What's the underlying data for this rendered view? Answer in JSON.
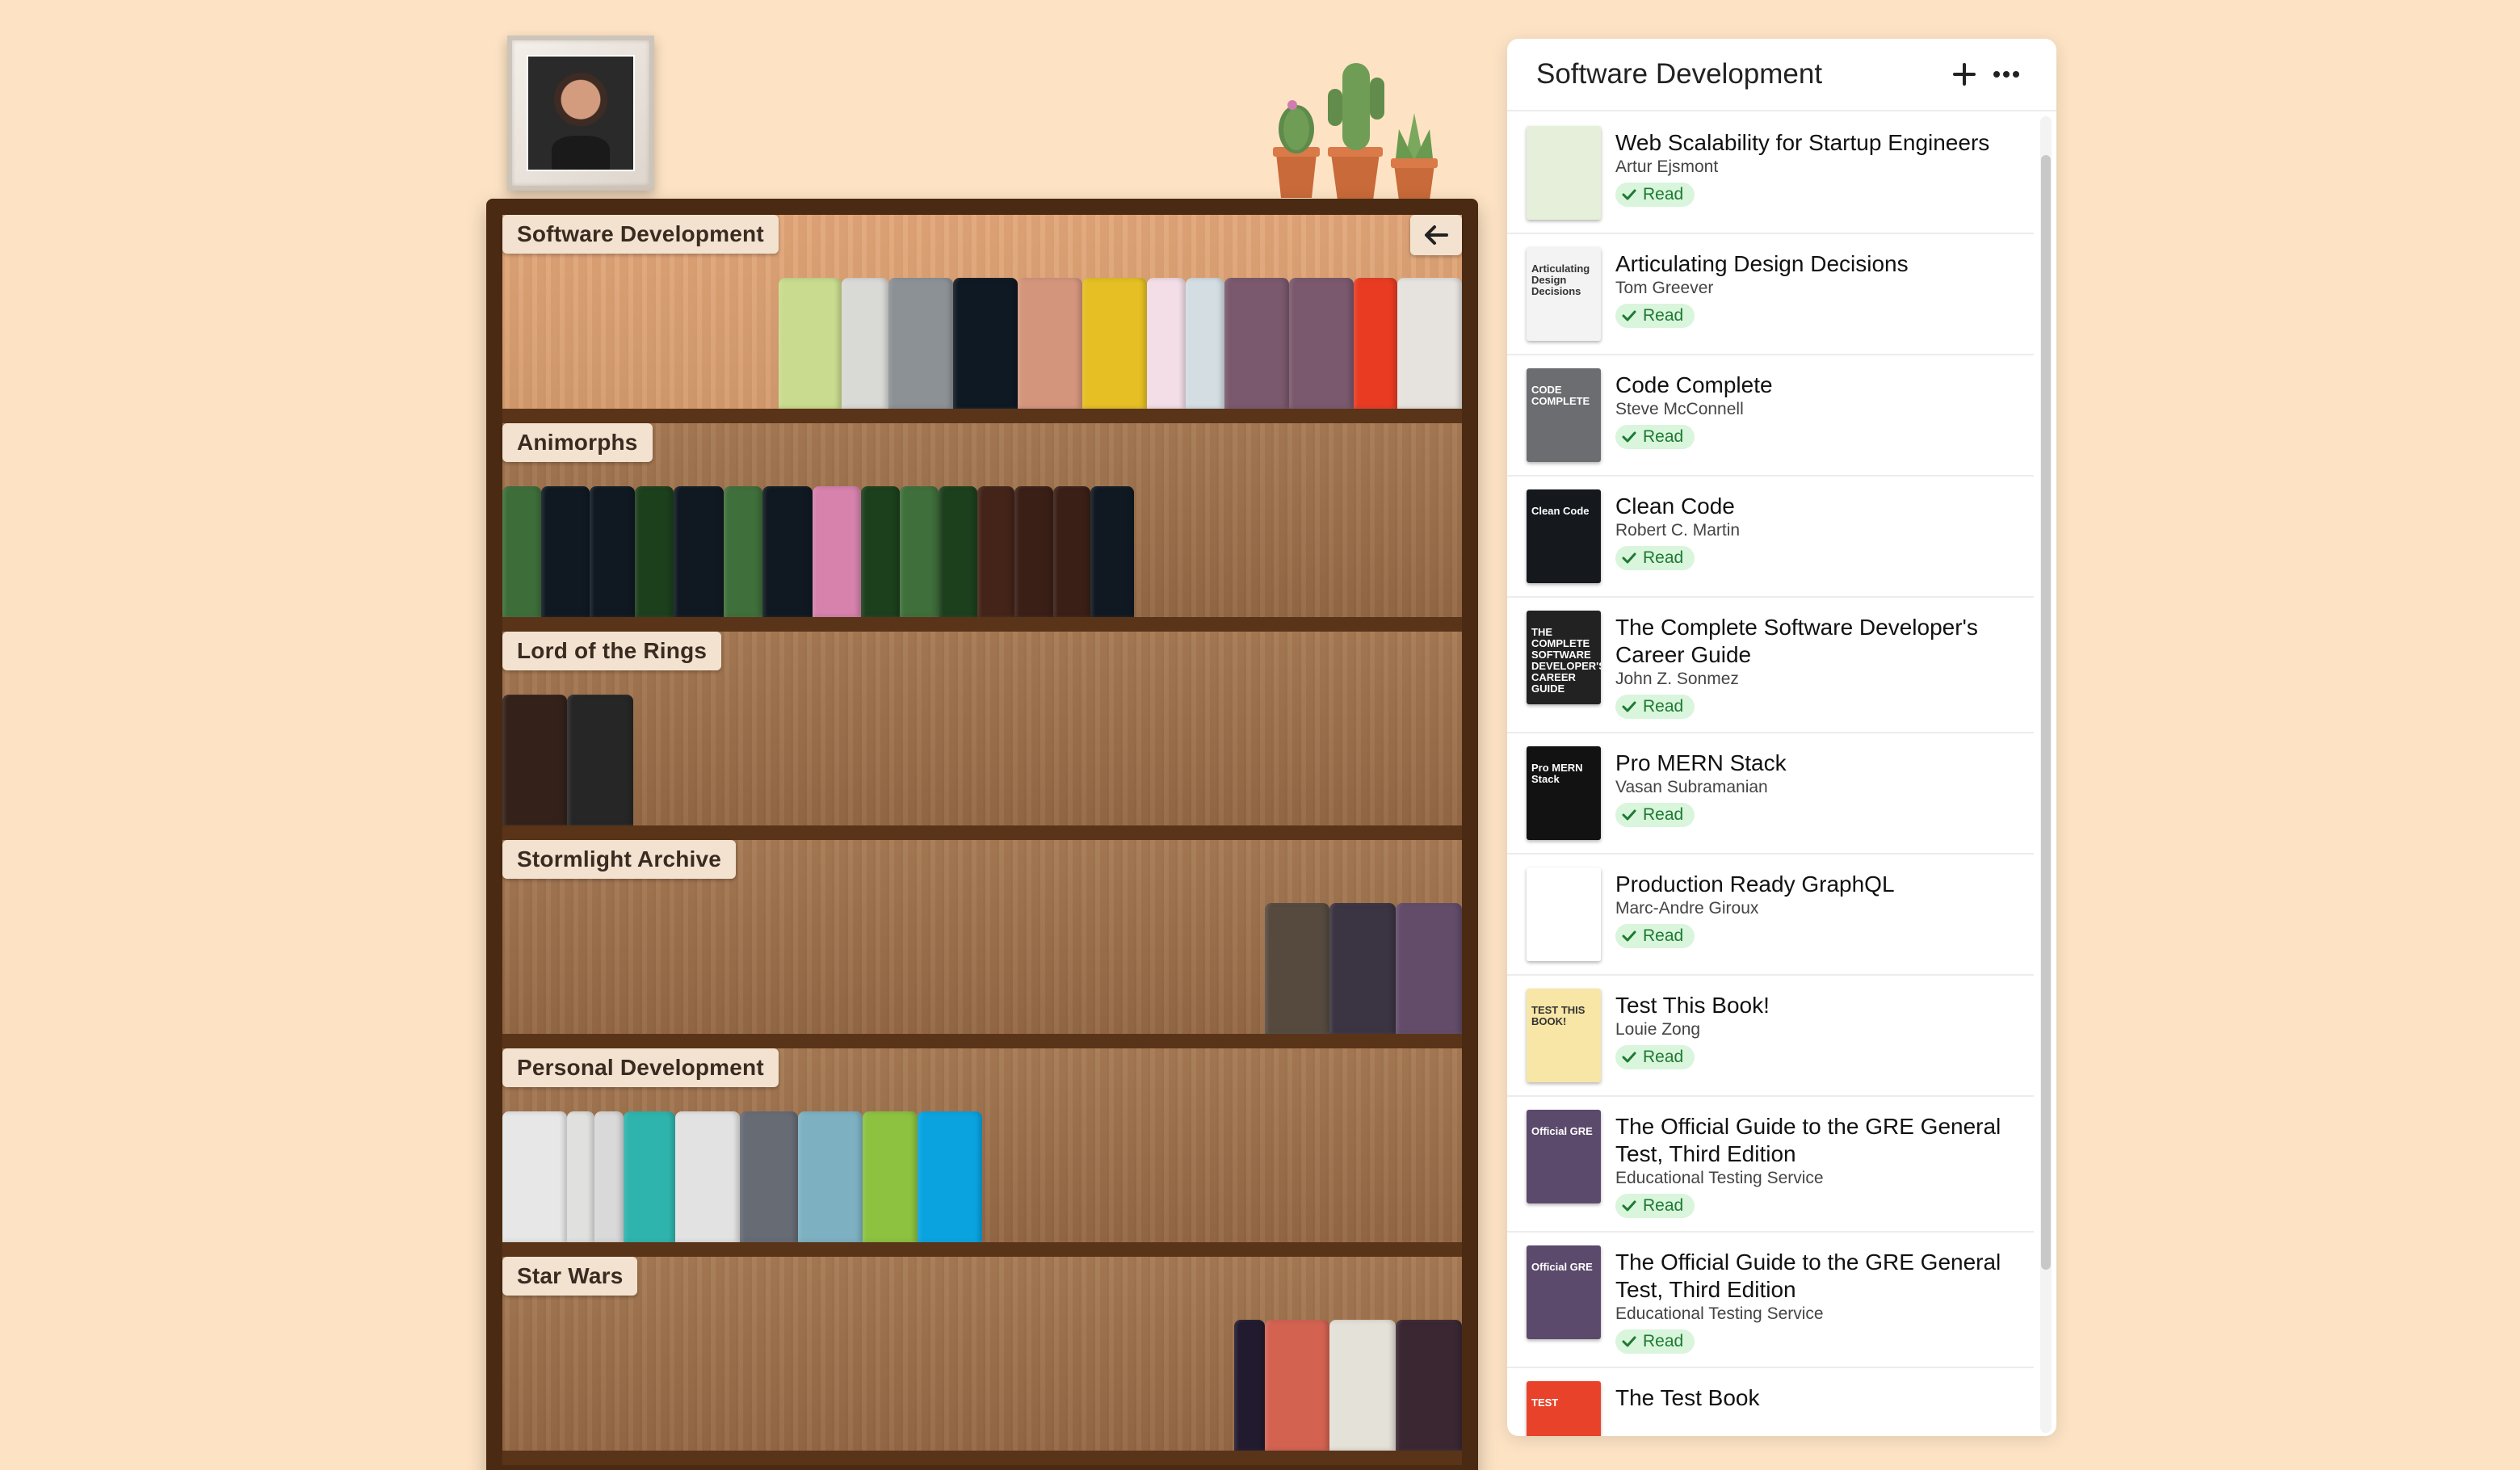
{
  "panel": {
    "title": "Software Development",
    "add_icon": "plus-icon",
    "more_icon": "ellipsis-icon",
    "books": [
      {
        "title": "Web Scalability for Startup Engineers",
        "author": "Artur Ejsmont",
        "status": "Read",
        "cover_color": "#e6efd9",
        "cover_text": ""
      },
      {
        "title": "Articulating Design Decisions",
        "author": "Tom Greever",
        "status": "Read",
        "cover_color": "#f3f3f3",
        "cover_text": "Articulating Design Decisions"
      },
      {
        "title": "Code Complete",
        "author": "Steve McConnell",
        "status": "Read",
        "cover_color": "#6b6d70",
        "cover_text": "CODE COMPLETE"
      },
      {
        "title": "Clean Code",
        "author": "Robert C. Martin",
        "status": "Read",
        "cover_color": "#15191e",
        "cover_text": "Clean Code"
      },
      {
        "title": "The Complete Software Developer's Career Guide",
        "author": "John Z. Sonmez",
        "status": "Read",
        "cover_color": "#222222",
        "cover_text": "THE COMPLETE SOFTWARE DEVELOPER'S CAREER GUIDE"
      },
      {
        "title": "Pro MERN Stack",
        "author": "Vasan Subramanian",
        "status": "Read",
        "cover_color": "#121212",
        "cover_text": "Pro MERN Stack"
      },
      {
        "title": "Production Ready GraphQL",
        "author": "Marc-Andre Giroux",
        "status": "Read",
        "cover_color": "#ffffff",
        "cover_text": ""
      },
      {
        "title": "Test This Book!",
        "author": "Louie Zong",
        "status": "Read",
        "cover_color": "#f7e6a5",
        "cover_text": "TEST THIS BOOK!"
      },
      {
        "title": "The Official Guide to the GRE General Test, Third Edition",
        "author": "Educational Testing Service",
        "status": "Read",
        "cover_color": "#5b4a6b",
        "cover_text": "Official GRE"
      },
      {
        "title": "The Official Guide to the GRE General Test, Third Edition",
        "author": "Educational Testing Service",
        "status": "Read",
        "cover_color": "#5b4a6b",
        "cover_text": "Official GRE"
      },
      {
        "title": "The Test Book",
        "author": "",
        "status": "",
        "cover_color": "#e8432a",
        "cover_text": "TEST"
      }
    ]
  },
  "shelves": [
    {
      "label": "Software Development",
      "align": "right",
      "books": [
        "#c9db8e",
        "#d9d9d6",
        "#8c9196",
        "#0f1923",
        "#d4957d",
        "#e5bf23",
        "#f3dde6",
        "#d3dde2",
        "#7a586d",
        "#7a586d",
        "#e93b22",
        "#e6e3df"
      ],
      "widths": [
        78,
        58,
        80,
        80,
        80,
        80,
        48,
        48,
        80,
        80,
        54,
        80
      ]
    },
    {
      "label": "Animorphs",
      "align": "left",
      "books": [
        "#3d6e3a",
        "#101922",
        "#101922",
        "#1c3f1c",
        "#101922",
        "#3f6f3a",
        "#101922",
        "#d682ad",
        "#1c3f1c",
        "#3f6f3a",
        "#1c3f1c",
        "#442418",
        "#3a1f16",
        "#3a1f16",
        "#101922"
      ],
      "widths": [
        48,
        60,
        56,
        48,
        62,
        48,
        62,
        60,
        48,
        48,
        48,
        46,
        48,
        46,
        54
      ]
    },
    {
      "label": "Lord of the Rings",
      "align": "left",
      "books": [
        "#33211a",
        "#262626"
      ],
      "widths": [
        80,
        82
      ]
    },
    {
      "label": "Stormlight Archive",
      "align": "right",
      "books": [
        "#564a3f",
        "#3b3442",
        "#624c6a"
      ],
      "widths": [
        80,
        82,
        82
      ]
    },
    {
      "label": "Personal Development",
      "align": "left",
      "books": [
        "#e7e7e7",
        "#e0e0df",
        "#d9d9d9",
        "#2fb4ad",
        "#e2e2e3",
        "#666b74",
        "#7db1c2",
        "#8cc23f",
        "#0aa3e0"
      ],
      "widths": [
        80,
        34,
        36,
        64,
        80,
        72,
        80,
        68,
        80
      ]
    },
    {
      "label": "Star Wars",
      "align": "right",
      "books": [
        "#221a2e",
        "#d36251",
        "#e4e1d8",
        "#3a2732"
      ],
      "widths": [
        38,
        80,
        82,
        82
      ]
    }
  ]
}
